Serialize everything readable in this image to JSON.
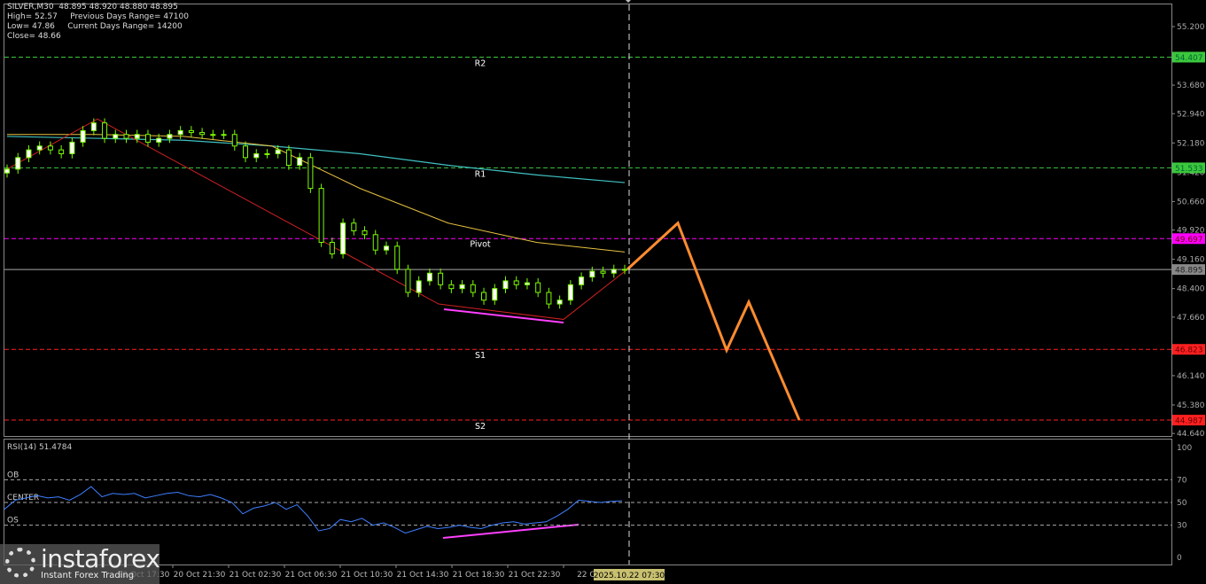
{
  "header": {
    "symbol_line": "SILVER,M30  48.895 48.920 48.880 48.895",
    "high": "High= 52.57",
    "prev_range": "Previous Days Range= 47100",
    "low": "Low= 47.86",
    "cur_range": "Current Days Range= 14200",
    "close": "Close= 48.66"
  },
  "logo": {
    "name": "instaforex",
    "tagline": "Instant Forex Trading"
  },
  "colors": {
    "candle": "#7CFC00",
    "ma_slow": "#40c0c0",
    "ma_fast": "#e8c040",
    "zigzag": "#d02020",
    "forecast": "#ff8c30",
    "divergence": "#ff40ff",
    "rsi": "#3f7fff"
  },
  "chart_data": [
    {
      "type": "candlestick",
      "title": "SILVER,M30",
      "ylim": [
        44.64,
        55.2
      ],
      "y_ticks": [
        "55.200",
        "53.680",
        "52.940",
        "52.180",
        "51.420",
        "50.660",
        "49.920",
        "49.160",
        "48.400",
        "47.660",
        "46.140",
        "45.380",
        "44.640"
      ],
      "x_ticks": [
        "20 Oct 17:30",
        "20 Oct 21:30",
        "21 Oct 02:30",
        "21 Oct 06:30",
        "21 Oct 10:30",
        "21 Oct 14:30",
        "21 Oct 18:30",
        "21 Oct 22:30",
        "22 Oct"
      ],
      "cursor_time": "2025.10.22 07:30",
      "current_price": "48.895",
      "levels": [
        {
          "name": "R2",
          "value": 54.407,
          "label": "54.407",
          "color": "#3cc83c"
        },
        {
          "name": "R1",
          "value": 51.533,
          "label": "51.533",
          "color": "#3cc83c"
        },
        {
          "name": "Pivot",
          "value": 49.697,
          "label": "49.697",
          "color": "#ff00ff"
        },
        {
          "name": "S1",
          "value": 46.823,
          "label": "46.823",
          "color": "#ff2020"
        },
        {
          "name": "S2",
          "value": 44.987,
          "label": "44.987",
          "color": "#ff2020"
        }
      ],
      "closes": [
        51.5,
        51.8,
        52.0,
        52.1,
        52.0,
        51.9,
        52.2,
        52.5,
        52.7,
        52.3,
        52.4,
        52.3,
        52.4,
        52.2,
        52.3,
        52.4,
        52.5,
        52.45,
        52.4,
        52.4,
        52.4,
        52.1,
        51.8,
        51.9,
        51.9,
        52.0,
        51.6,
        51.8,
        51.0,
        49.6,
        49.3,
        50.1,
        49.9,
        49.8,
        49.4,
        49.5,
        48.9,
        48.3,
        48.6,
        48.8,
        48.5,
        48.4,
        48.5,
        48.3,
        48.1,
        48.4,
        48.6,
        48.5,
        48.55,
        48.3,
        48.0,
        48.1,
        48.5,
        48.7,
        48.85,
        48.8,
        48.9,
        48.895
      ],
      "ma_slow": [
        52.35,
        52.3,
        52.25,
        52.1,
        51.9,
        51.6,
        51.35,
        51.15
      ],
      "ma_fast": [
        52.4,
        52.4,
        52.35,
        52.1,
        51.0,
        50.1,
        49.6,
        49.35
      ],
      "forecast": [
        48.9,
        50.1,
        46.8,
        48.05,
        44.99
      ]
    },
    {
      "type": "line",
      "title": "RSI(14) 51.4784",
      "ylim": [
        0,
        100
      ],
      "y_ticks": [
        "100",
        "70",
        "50",
        "30",
        "0"
      ],
      "level_labels": [
        "OB",
        "CENTER",
        "OS"
      ],
      "values": [
        44,
        52,
        54,
        56,
        54,
        55,
        52,
        57,
        64,
        55,
        58,
        57,
        58,
        54,
        56,
        58,
        59,
        56,
        55,
        57,
        54,
        50,
        40,
        45,
        47,
        50,
        44,
        48,
        38,
        25,
        27,
        35,
        33,
        36,
        30,
        32,
        28,
        23,
        26,
        29,
        27,
        28,
        30,
        28,
        27,
        30,
        32,
        33,
        31,
        32,
        33,
        38,
        44,
        52,
        51,
        50,
        51,
        51.5
      ]
    }
  ]
}
